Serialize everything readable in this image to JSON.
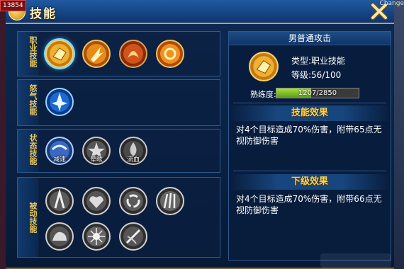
{
  "topbar": {
    "coins": "13854",
    "right_text": "Change"
  },
  "window": {
    "title": "技能"
  },
  "categories": [
    {
      "label": "职业技能"
    },
    {
      "label": "怒气技能"
    },
    {
      "label": "状态技能"
    },
    {
      "label": "被动技能"
    }
  ],
  "status_skills": [
    "减速",
    "晕眩",
    "流血"
  ],
  "detail": {
    "skill_name": "男普通攻击",
    "type_label": "类型:职业技能",
    "level_label": "等级:56/100",
    "proficiency_label": "熟练度:",
    "proficiency_text": "1207/2850",
    "proficiency_fraction": 0.4235,
    "effect_title": "技能效果",
    "effect_text": "对4个目标造成70%伤害，附带65点无视防御伤害",
    "next_title": "下级效果",
    "next_text": "对4个目标造成70%伤害，附带66点无视防御伤害"
  },
  "colors": {
    "accent_gold": "#f5d35a",
    "frame_blue": "#0d2a52",
    "progress_green": "#8ccf2c"
  },
  "icons": {
    "close": "close-x-icon",
    "title": "skill-book-icon"
  }
}
